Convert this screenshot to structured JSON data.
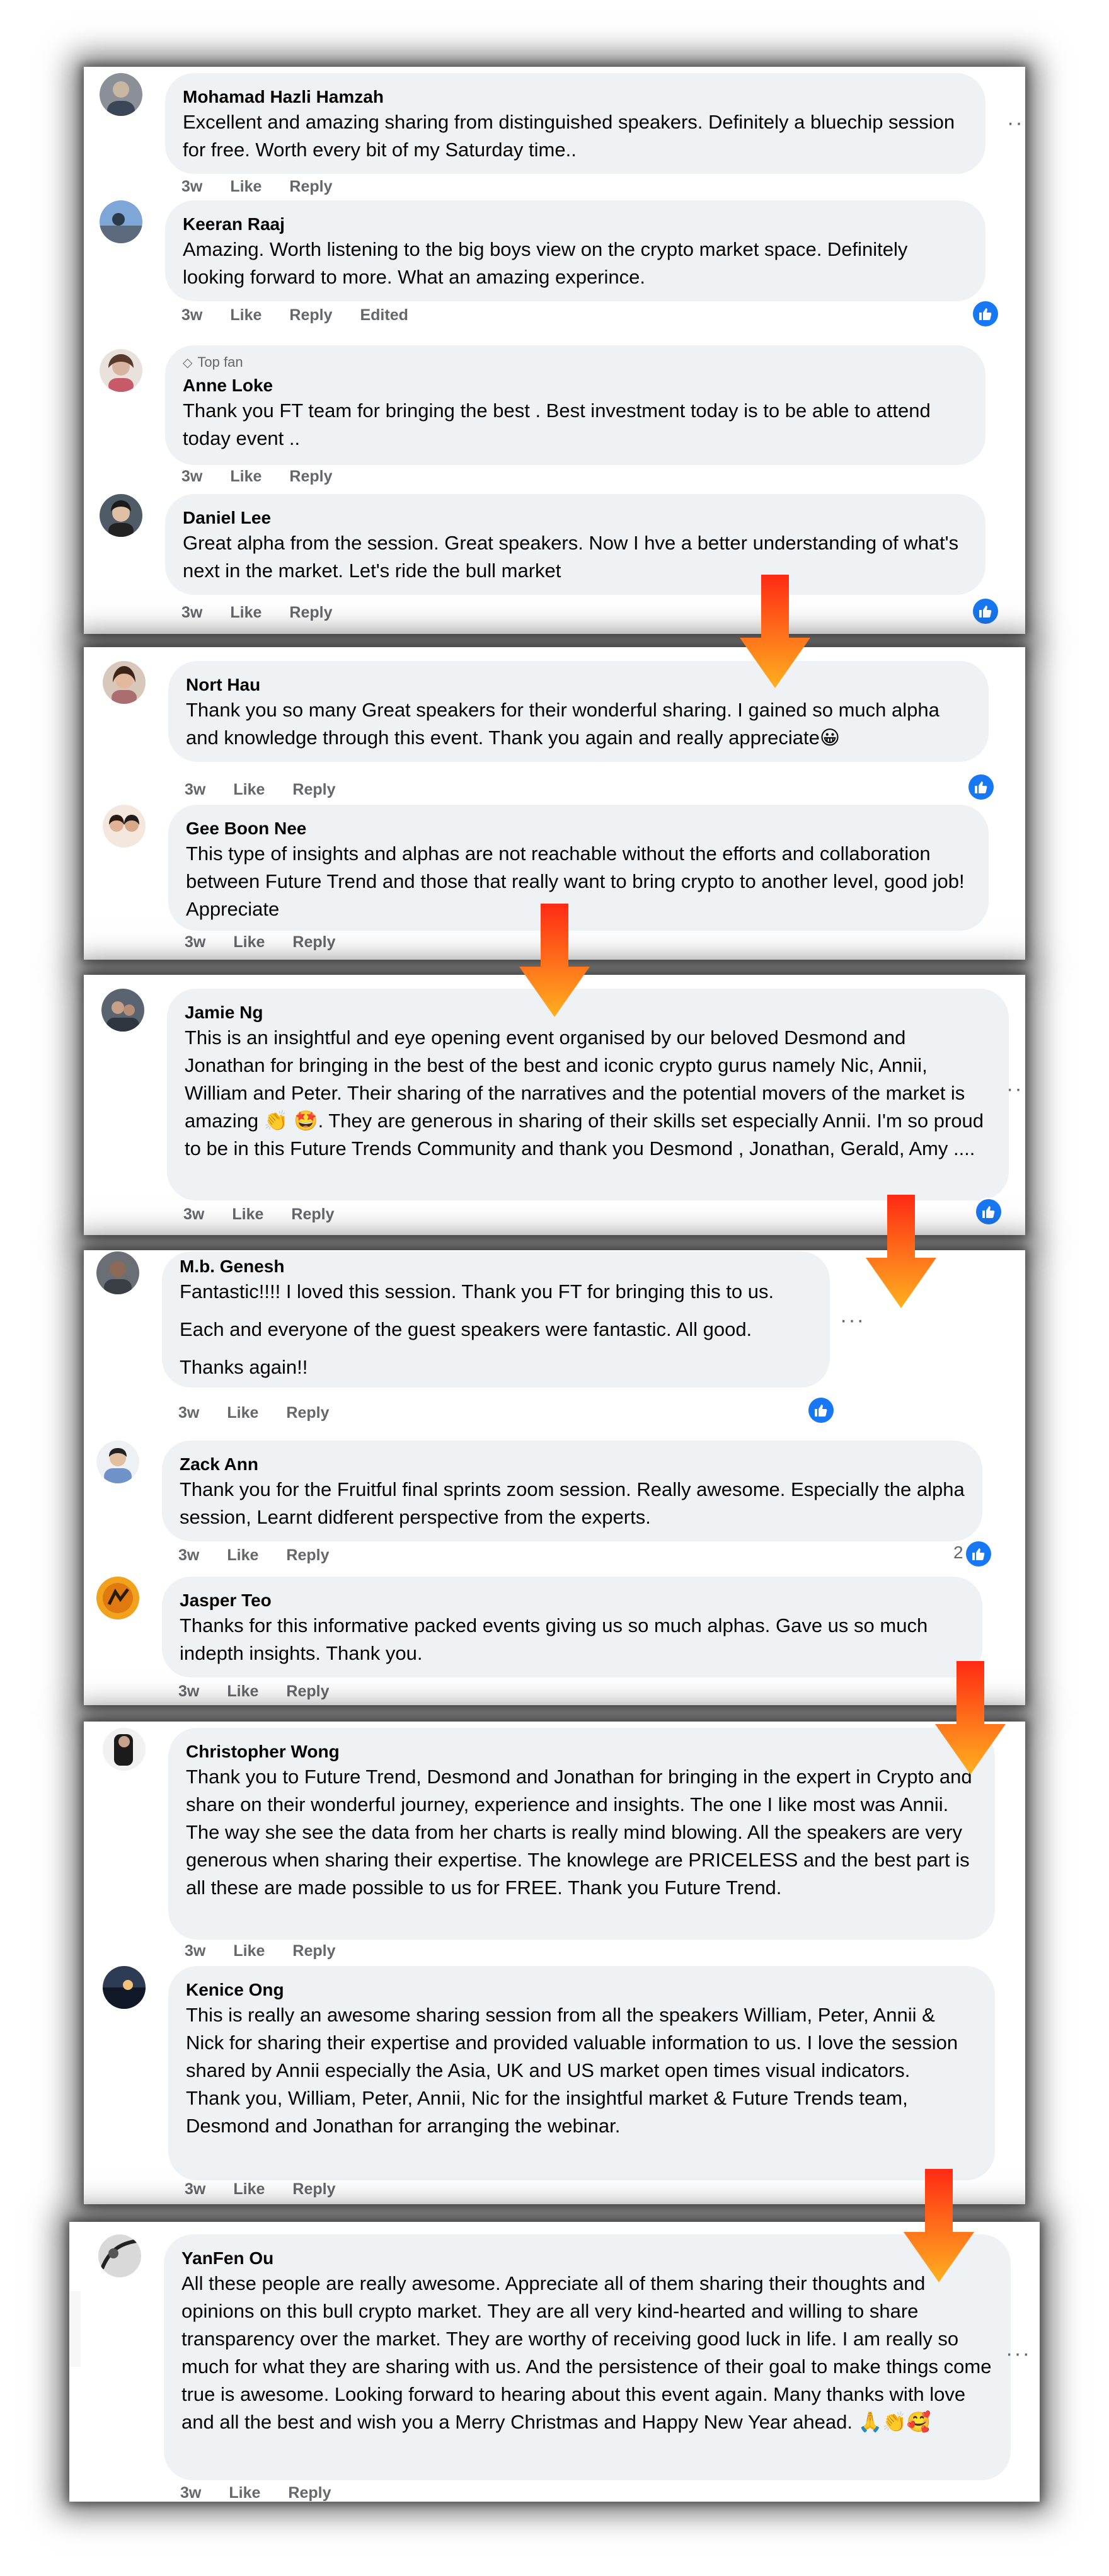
{
  "common": {
    "time": "3w",
    "like": "Like",
    "reply": "Reply",
    "edited": "Edited",
    "more": "···"
  },
  "comments": [
    {
      "name": "Mohamad Hazli Hamzah",
      "text": "Excellent and amazing sharing from distinguished speakers. Definitely a bluechip session for free. Worth every bit of my Saturday time.."
    },
    {
      "name": "Keeran Raaj",
      "text": "Amazing. Worth listening to the big boys view on the crypto market space. Definitely looking forward to more. What an amazing experince."
    },
    {
      "badge": "Top fan",
      "name": "Anne Loke",
      "text": "Thank you FT team for bringing the best . Best investment today is to be able to attend today event .."
    },
    {
      "name": "Daniel Lee",
      "text": "Great alpha from the session. Great speakers. Now I hve a better understanding of what's next in the market. Let's ride the bull market"
    },
    {
      "name": "Nort Hau",
      "text": "Thank you so many Great speakers for their wonderful sharing. I gained so much alpha and knowledge through this event. Thank you again and really appreciate😀"
    },
    {
      "name": "Gee Boon Nee",
      "text": "This type of insights and alphas are not reachable without the efforts and collaboration between Future Trend and those that really want to bring crypto to another level, good job! Appreciate"
    },
    {
      "name": "Jamie Ng",
      "text": "This is an insightful and eye opening event organised by our beloved Desmond and Jonathan for bringing in the best of the best and iconic crypto gurus namely Nic, Annii, William and Peter. Their sharing of the narratives and the potential movers of the market is amazing 👏 🤩. They are generous in sharing of their skills set especially Annii. I'm so proud to be in this Future Trends Community and thank you Desmond , Jonathan, Gerald, Amy ...."
    },
    {
      "name": "M.b. Genesh",
      "paragraphs": [
        "Fantastic!!!! I loved this session. Thank you FT for bringing this to us.",
        "Each and everyone of the guest speakers were fantastic. All good.",
        "Thanks again!!"
      ]
    },
    {
      "name": "Zack Ann",
      "text": "Thank you for the Fruitful final sprints zoom session. Really awesome. Especially the alpha session, Learnt didferent perspective from the experts.",
      "reaction_count": "2"
    },
    {
      "name": "Jasper Teo",
      "text": "Thanks for this informative packed events giving us so much alphas. Gave us so much indepth insights. Thank you."
    },
    {
      "name": "Christopher Wong",
      "text": "Thank you to Future Trend, Desmond and Jonathan for bringing in the expert in Crypto and share on their wonderful journey, experience and insights. The one I like most was Annii. The way she see the data from her charts is really mind blowing. All the speakers are very generous when sharing their expertise. The knowlege are PRICELESS and the best part is all these are made possible to us for FREE. Thank you Future Trend."
    },
    {
      "name": "Kenice Ong",
      "paragraphs": [
        "This is really an awesome sharing session from all the speakers William, Peter, Annii & Nick for sharing their expertise and provided valuable information to us. I love the session shared by Annii especially the Asia, UK and US market open times visual indicators.",
        "Thank you, William, Peter, Annii, Nic for the insightful market & Future Trends team, Desmond and Jonathan for arranging the webinar."
      ]
    },
    {
      "name": "YanFen Ou",
      "text": "All these people are really awesome. Appreciate all of them sharing their thoughts and opinions on this bull crypto market. They are all very kind-hearted and willing to share transparency over the market. They are worthy of receiving good luck in life. I am really so much for what they are sharing with us. And the persistence of their goal to make things come true is awesome. Looking forward to hearing about this event again. Many thanks with love and all the best and wish you a Merry Christmas and Happy New Year ahead. 🙏👏🥰"
    }
  ],
  "colors": {
    "bubble": "#eff2f5",
    "like_blue": "#1877f2",
    "meta_gray": "#65676b",
    "arrow_top": "#ff2a14",
    "arrow_bottom": "#ffb020"
  },
  "icons": [
    "thumbs-up-icon",
    "down-arrow-icon",
    "more-options-icon",
    "diamond-icon"
  ]
}
